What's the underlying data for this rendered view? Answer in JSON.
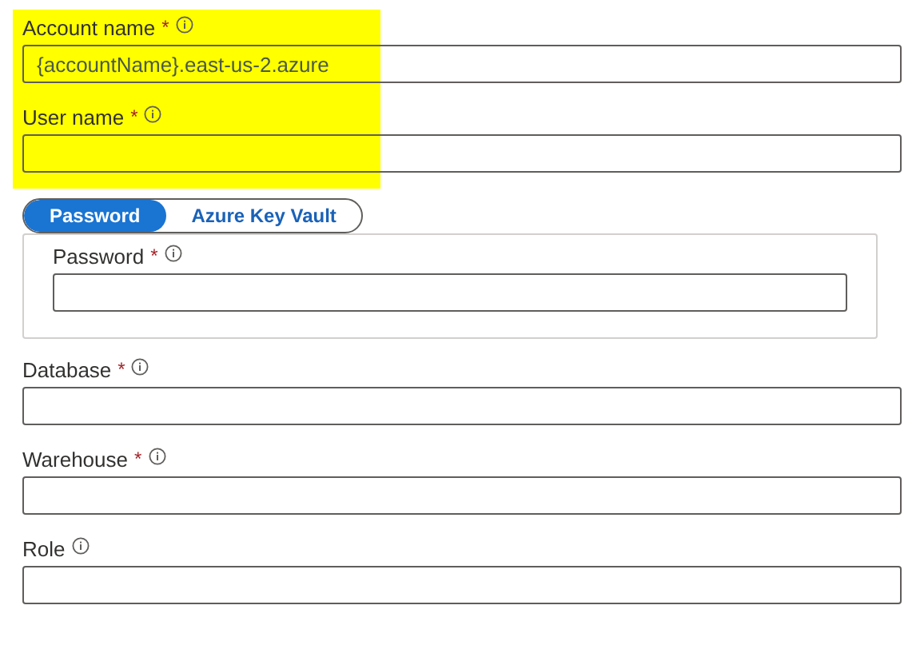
{
  "top_fields": [
    {
      "label": "Account name",
      "required_mark": "*",
      "value": "{accountName}.east-us-2.azure",
      "highlighted": true
    },
    {
      "label": "User name",
      "required_mark": "*",
      "highlighted": true
    }
  ],
  "auth": {
    "tabs": [
      {
        "label": "Password",
        "selected": true
      },
      {
        "label": "Azure Key Vault",
        "selected": false
      }
    ],
    "field": {
      "label": "Password",
      "required_mark": "*",
      "highlighted": false
    }
  },
  "bottom_fields": [
    {
      "label": "Database",
      "required_mark": "*",
      "highlighted": false
    },
    {
      "label": "Warehouse",
      "required_mark": "*",
      "highlighted": false
    },
    {
      "label": "Role",
      "highlighted": false
    }
  ]
}
